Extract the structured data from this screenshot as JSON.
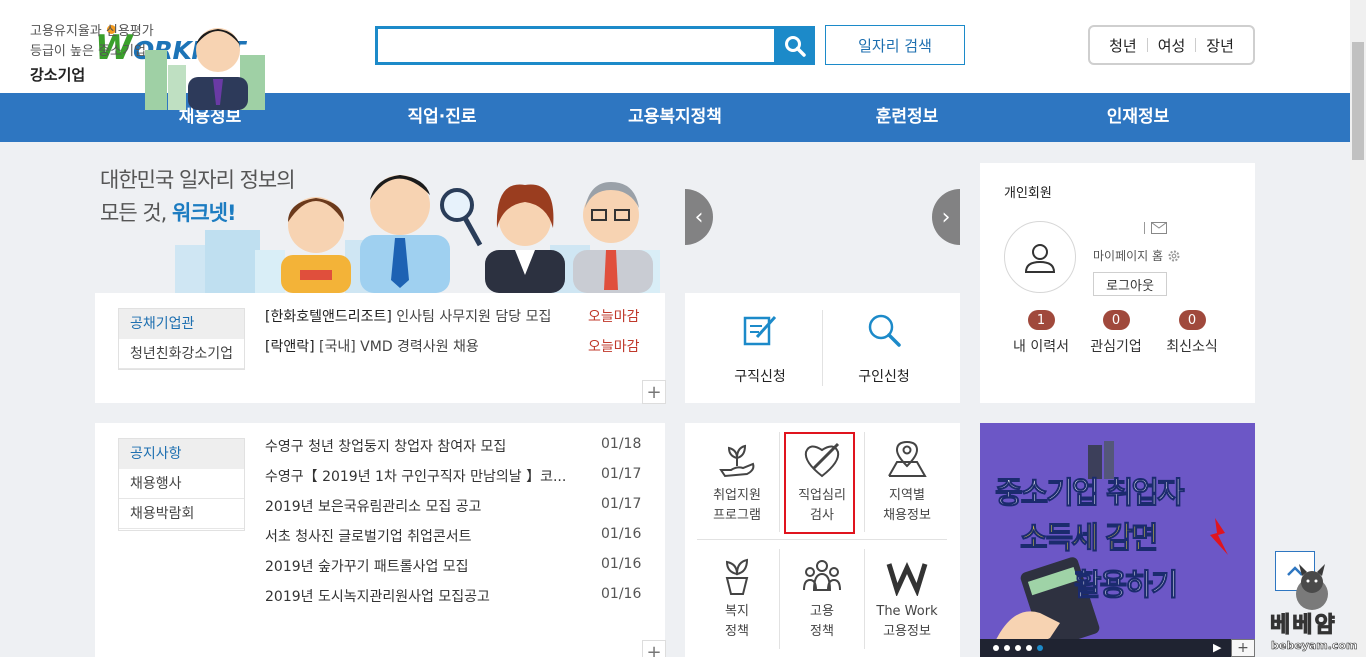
{
  "header": {
    "logo_rest": "ORKNET",
    "search_placeholder": "",
    "job_search_label": "일자리 검색",
    "quick_links": [
      "청년",
      "여성",
      "장년"
    ]
  },
  "nav": {
    "items": [
      "채용정보",
      "직업·진로",
      "고용복지정책",
      "훈련정보",
      "인재정보"
    ]
  },
  "hero": {
    "line1": "대한민국 일자리 정보의",
    "line2_prefix": "모든 것,",
    "line2_brand": "워크넷!"
  },
  "recruit_card": {
    "tabs": [
      "공채기업관",
      "청년친화강소기업"
    ],
    "rows": [
      {
        "company": "[한화호텔앤드리조트]",
        "title": "인사팀 사무지원 담당 모집",
        "status": "오늘마감"
      },
      {
        "company": "[락앤락]",
        "title": "[국내] VMD 경력사원 채용",
        "status": "오늘마감"
      }
    ],
    "more": "+"
  },
  "notice_card": {
    "tabs": [
      "공지사항",
      "채용행사",
      "채용박람회"
    ],
    "rows": [
      {
        "title": "수영구 청년 창업둥지 창업자 참여자 모집",
        "date": "01/18"
      },
      {
        "title": "수영구【 2019년 1차 구인구직자 만남의날 】코...",
        "date": "01/17"
      },
      {
        "title": "2019년 보은국유림관리소 모집 공고",
        "date": "01/17"
      },
      {
        "title": "서초 청사진 글로벌기업 취업콘서트",
        "date": "01/16"
      },
      {
        "title": "2019년 숲가꾸기 패트롤사업 모집",
        "date": "01/16"
      },
      {
        "title": "2019년 도시녹지관리원사업 모집공고",
        "date": "01/16"
      }
    ],
    "more": "+"
  },
  "slide": {
    "line1": "고용유지율과 신용평가",
    "line2": "등급이 높은 중소기업",
    "title": "강소기업",
    "prev": "‹",
    "next": "›"
  },
  "apply": {
    "job_seek": "구직신청",
    "job_offer": "구인신청"
  },
  "services": [
    {
      "line1": "취업지원",
      "line2": "프로그램",
      "icon": "hand-sprout-icon"
    },
    {
      "line1": "직업심리",
      "line2": "검사",
      "icon": "heart-pen-icon"
    },
    {
      "line1": "지역별",
      "line2": "채용정보",
      "icon": "map-pin-icon"
    },
    {
      "line1": "복지",
      "line2": "정책",
      "icon": "plant-pot-icon"
    },
    {
      "line1": "고용",
      "line2": "정책",
      "icon": "people-group-icon"
    },
    {
      "line1": "The Work",
      "line2": "고용정보",
      "icon": "w-logo-icon"
    }
  ],
  "member": {
    "title": "개인회원",
    "mypage": "마이페이지 홈",
    "logout": "로그아웃",
    "counts": [
      {
        "label": "내 이력서",
        "value": "1"
      },
      {
        "label": "관심기업",
        "value": "0"
      },
      {
        "label": "최신소식",
        "value": "0"
      }
    ]
  },
  "banner": {
    "line1": "중소기업 취업자",
    "line2": "소득세 감면",
    "line3": "활용하기"
  },
  "watermark": {
    "text": "베베얌",
    "url": "bebeyam.com"
  },
  "colors": {
    "nav_bg": "#2e76c1",
    "accent": "#1c8ac9",
    "badge": "#a0493c",
    "highlight_box": "#e0141e",
    "banner_bg": "#6c57c6"
  }
}
